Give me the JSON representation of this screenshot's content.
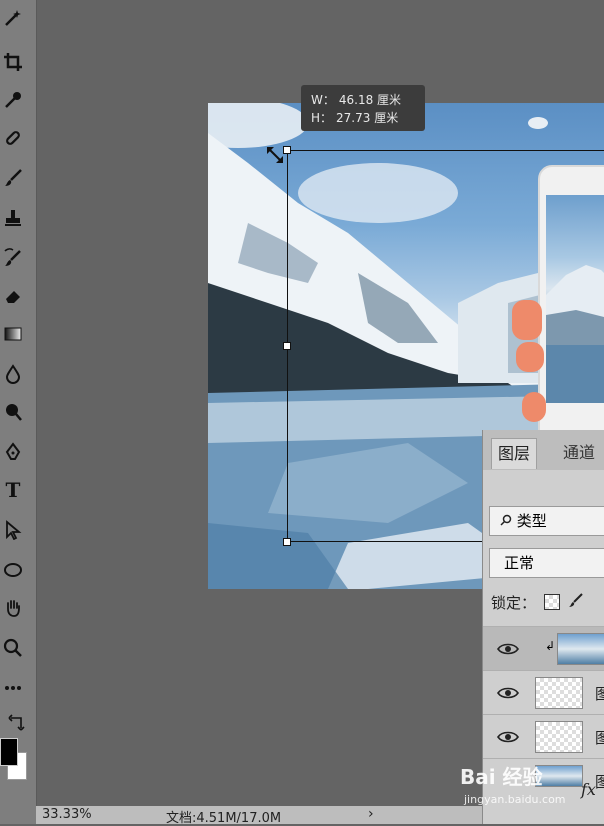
{
  "transform_tooltip": {
    "w_label": "W：",
    "w_value": "46.18 厘米",
    "h_label": "H：",
    "h_value": "27.73 厘米"
  },
  "layers_panel": {
    "tabs": [
      "图层",
      "通道"
    ],
    "filter_value": "类型",
    "blend_mode": "正常",
    "lock_label": "锁定：",
    "fx_label": "fx",
    "layers": [
      {
        "name": "",
        "thumbnail": "landscape-photo",
        "selected": true,
        "clipped": true
      },
      {
        "name": "图",
        "thumbnail": "transparent",
        "selected": false,
        "clipped": false
      },
      {
        "name": "图",
        "thumbnail": "transparent-hand",
        "selected": false,
        "clipped": false
      },
      {
        "name": "图",
        "thumbnail": "landscape-photo",
        "selected": false,
        "clipped": false
      }
    ]
  },
  "status_bar": {
    "zoom": "33.33%",
    "doc_info": "文档:4.51M/17.0M",
    "arrow": "›"
  },
  "watermark": {
    "logo": "Bai 经验",
    "url": "jingyan.baidu.com"
  },
  "toolbar": {
    "text_tool_glyph": "T",
    "tools": [
      "magic-wand-icon",
      "crop-icon",
      "eyedropper-icon",
      "healing-brush-icon",
      "brush-icon",
      "clone-stamp-icon",
      "history-brush-icon",
      "eraser-icon",
      "gradient-icon",
      "blur-icon",
      "dodge-icon",
      "pen-icon",
      "text-tool-icon",
      "path-selection-icon",
      "ellipse-shape-icon",
      "hand-icon",
      "zoom-icon",
      "more-tools-icon",
      "swap-colors-icon"
    ]
  },
  "colors": {
    "workspace": "#646464",
    "foreground": "#000000",
    "background": "#ffffff"
  }
}
